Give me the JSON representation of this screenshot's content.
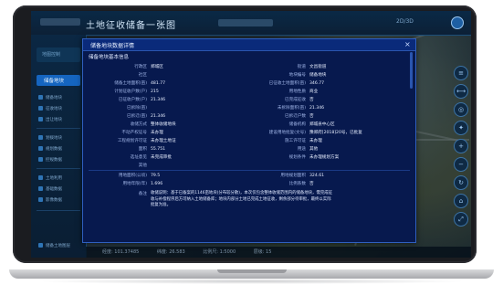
{
  "app": {
    "title": "土地征收储备一张图",
    "top_right_text": "2D/3D"
  },
  "sidebar": {
    "top_button": "地图控制",
    "active_item": "储备地块",
    "items": [
      {
        "label": "储备地块"
      },
      {
        "label": "征收地块"
      },
      {
        "label": "出让地块"
      },
      {
        "label": "划拨地块"
      },
      {
        "label": "规划数据"
      },
      {
        "label": "控规数据"
      },
      {
        "label": "土地利用"
      },
      {
        "label": "基础数据"
      },
      {
        "label": "影像数据"
      },
      {
        "label": "储备土地图层"
      }
    ]
  },
  "toolbar": {
    "tools": [
      {
        "icon": "layers-icon",
        "glyph": "≡"
      },
      {
        "icon": "measure-icon",
        "glyph": "⟷"
      },
      {
        "icon": "location-icon",
        "glyph": "◎"
      },
      {
        "icon": "compass-icon",
        "glyph": "✦"
      },
      {
        "icon": "zoom-in-icon",
        "glyph": "+"
      },
      {
        "icon": "zoom-out-icon",
        "glyph": "−"
      },
      {
        "icon": "refresh-icon",
        "glyph": "↻"
      },
      {
        "icon": "home-icon",
        "glyph": "⌂"
      },
      {
        "icon": "fullscreen-icon",
        "glyph": "⤢"
      }
    ]
  },
  "status": {
    "items": [
      "经度: 101.37485",
      "纬度: 26.583",
      "比例尺: 1:5000",
      "层级: 15"
    ]
  },
  "dialog": {
    "title": "储备地块数据详情",
    "section": "储备地块基本信息",
    "close_glyph": "×",
    "rows": [
      {
        "l1": "行政区",
        "v1": "郑城区",
        "l2": "街道",
        "v2": "文昌街道"
      },
      {
        "l1": "社区",
        "v1": "",
        "l2": "地块编号",
        "v2": "储备地块"
      },
      {
        "l1": "储备土地面积(亩)",
        "v1": "481.77",
        "l2": "已征收土地面积(亩)",
        "v2": "346.77"
      },
      {
        "l1": "计划征收户数(户)",
        "v1": "215",
        "l2": "用地性质",
        "v2": "商业"
      },
      {
        "l1": "已征收户数(户)",
        "v1": "21.346",
        "l2": "已完成征收",
        "v2": "否"
      },
      {
        "l1": "已拆除(亩)",
        "v1": "",
        "l2": "未拆除面积(亩)",
        "v2": "21.346"
      },
      {
        "l1": "已拆迁(亩)",
        "v1": "21.346",
        "l2": "已拆迁户数",
        "v2": "否"
      },
      {
        "l1": "收储方式",
        "v1": "整体收储地块",
        "l2": "储备机构",
        "v2": "郑城县中心区"
      },
      {
        "l1": "不动产权证号",
        "v1": "未办理",
        "l2": "建设用地批复(文号)",
        "v2": "豫郑府[2018]20号，已批复"
      },
      {
        "l1": "工程规划许可证",
        "v1": "未办理土地证",
        "l2": "施工许可证",
        "v2": "未办理"
      },
      {
        "l1": "面积",
        "v1": "55.751",
        "l2": "用途",
        "v2": "其他"
      },
      {
        "l1": "选址意见",
        "v1": "未完成审批",
        "l2": "规划条件",
        "v2": "未办理规划方案"
      },
      {
        "l1": "其他",
        "v1": "",
        "l2": "",
        "v2": ""
      },
      {
        "l1": "用地面积(公顷)",
        "v1": "79.5",
        "l2": "用地规划面积",
        "v2": "324.61"
      },
      {
        "l1": "用地年限(年)",
        "v1": "1.696",
        "l2": "比例系数",
        "v2": "否"
      },
      {
        "l1": "容积率",
        "v1": "",
        "l2": "",
        "v2": ""
      }
    ],
    "paragraph_label": "备注",
    "paragraph": "收储说明：基于已备案的1146亩地块(分布较分散)，本次仅包含整体收储范围内的储备地块，需完成征收与补偿程序后方可纳入土地储备库；地块内部分土地已完成土地征收，剩余部分待审批，最终以实际批复为准。"
  }
}
